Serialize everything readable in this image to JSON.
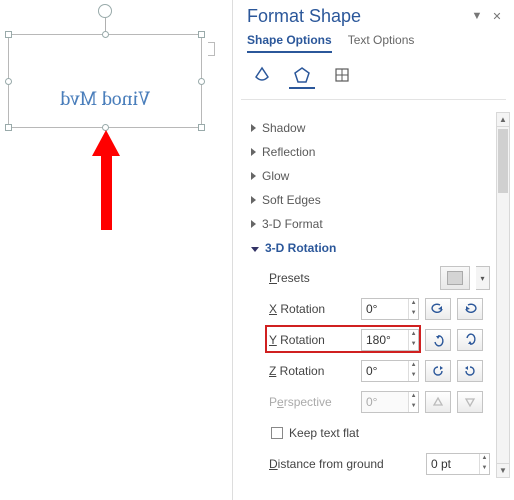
{
  "canvas": {
    "text": "Vinod Mvd"
  },
  "panel": {
    "title": "Format Shape",
    "tabs": {
      "shape_options": "Shape Options",
      "text_options": "Text Options"
    },
    "sections": {
      "shadow": "Shadow",
      "reflection": "Reflection",
      "glow": "Glow",
      "soft_edges": "Soft Edges",
      "format3d": "3-D Format",
      "rotation3d": "3-D Rotation"
    },
    "rotation3d": {
      "presets_label": "Presets",
      "x_label_pre": "X",
      "x_label_post": " Rotation",
      "x_value": "0°",
      "y_label_pre": "Y",
      "y_label_post": " Rotation",
      "y_value": "180°",
      "z_label_pre": "Z",
      "z_label_post": " Rotation",
      "z_value": "0°",
      "perspective_label": "Perspective",
      "perspective_value": "0°",
      "keep_flat_pre": "K",
      "keep_flat_post": "eep text flat",
      "distance_label": "Distance from ground",
      "distance_value": "0 pt"
    }
  }
}
